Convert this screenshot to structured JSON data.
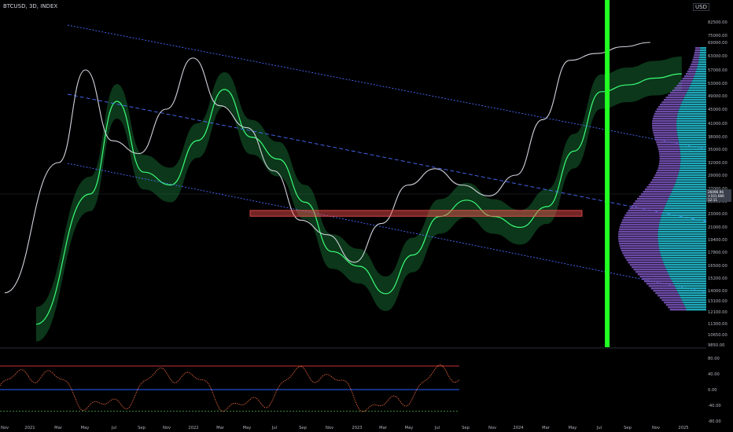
{
  "header": {
    "symbol": "BTCUSD, 3D, INDEX",
    "currency": "USD"
  },
  "price_tag": {
    "price": "26096.96",
    "change": "+101.666",
    "time": "12:11"
  },
  "chart_data": {
    "type": "line",
    "title": "BTCUSD, 3D, INDEX",
    "xlabel": "",
    "ylabel": "",
    "log_scale": true,
    "ylim": [
      9850,
      90000
    ],
    "x_ticks": [
      "Nov",
      "2021",
      "Mar",
      "May",
      "Jul",
      "Sep",
      "Nov",
      "2022",
      "Mar",
      "May",
      "Jul",
      "Sep",
      "Nov",
      "2023",
      "Mar",
      "May",
      "Jul",
      "Sep",
      "Nov",
      "2024",
      "Mar",
      "May",
      "Jul",
      "Sep",
      "Nov",
      "2025"
    ],
    "y_ticks": [
      82500,
      75000,
      69000,
      63000,
      57000,
      53000,
      49000,
      45000,
      41000,
      38000,
      35000,
      32000,
      29000,
      27000,
      25000,
      23000,
      21000,
      19400,
      17800,
      16500,
      15200,
      14000,
      13100,
      12100,
      11300,
      10650,
      9850
    ],
    "y_tick_labels": [
      "82500.00",
      "75000.00",
      "69000.00",
      "63000.00",
      "57000.00",
      "53000.00",
      "49000.00",
      "45000.00",
      "41000.00",
      "38000.00",
      "35000.00",
      "32000.00",
      "29000.00",
      "27000.00",
      "25000.00",
      "23000.00",
      "21000.00",
      "19400.00",
      "17800.00",
      "16500.00",
      "15200.00",
      "14000.00",
      "13100.00",
      "12100.00",
      "11300.00",
      "10650.00",
      "9850.00"
    ],
    "price_series": {
      "t": [
        0,
        2,
        3,
        4,
        5,
        6,
        7,
        8,
        9,
        10,
        11,
        12,
        13,
        14,
        15,
        16,
        17,
        18,
        19,
        20,
        21,
        22,
        23,
        24
      ],
      "close": [
        13800,
        32000,
        57000,
        37000,
        34000,
        45000,
        62000,
        46000,
        40000,
        30000,
        22000,
        20000,
        16800,
        21500,
        27500,
        30500,
        27500,
        25800,
        29000,
        42000,
        61000,
        64000,
        67000,
        69000
      ]
    },
    "resistance_zone": [
      22600,
      23500
    ],
    "green_vertical_at": 22.4,
    "oscillator": {
      "y_ticks": [
        80,
        40,
        0,
        -40,
        -80
      ],
      "y_tick_labels": [
        "80.00",
        "40.00",
        "0.00",
        "-40.00",
        "-80.00"
      ],
      "levels": [
        60,
        0,
        -55
      ]
    },
    "colors": {
      "up": "#d1d4dc",
      "down": "#787b86",
      "band_green": "#1b7a3a",
      "band_red": "#7a1b2e",
      "channel": "#4a6cff",
      "vertical": "#22ff22",
      "zone": "#ff5252",
      "profile_a": "#26c6da",
      "profile_b": "#7e57c2",
      "osc_red": "#ff4444",
      "osc_blue": "#2962ff",
      "osc_green": "#4caf50"
    }
  }
}
